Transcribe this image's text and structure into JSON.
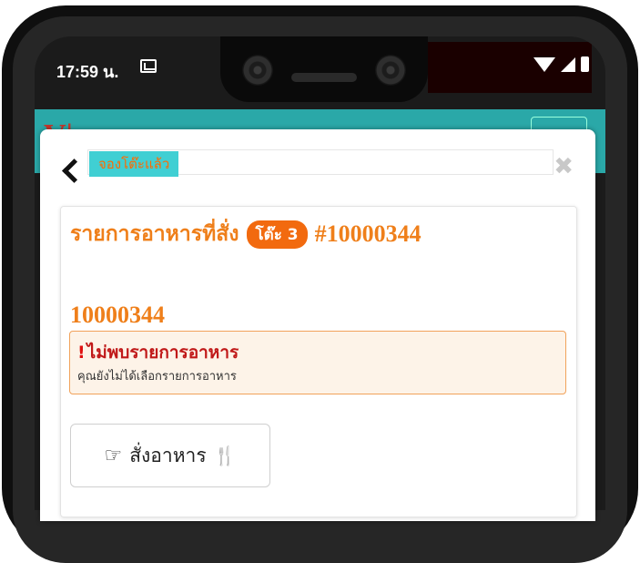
{
  "status_bar": {
    "time": "17:59 น."
  },
  "modal": {
    "tab_label": "จองโต๊ะแล้ว",
    "close_symbol": "✖",
    "title": "รายการอาหารที่สั่ง",
    "table_badge": "โต๊ะ 3",
    "order_number_header": "#10000344",
    "order_number": "10000344",
    "alert": {
      "title": "ไม่พบรายการอาหาร",
      "subtitle": "คุณยังไม่ได้เลือกรายการอาหาร"
    },
    "order_button": {
      "label": "สั่งอาหาร"
    }
  },
  "icons": {
    "back": "chevron-left-icon",
    "close": "close-icon",
    "hand": "hand-point-icon",
    "utensils": "utensils-icon",
    "mail": "mail-icon",
    "wifi": "wifi-icon",
    "signal": "signal-icon",
    "battery": "battery-icon"
  },
  "colors": {
    "accent": "#ef7f1a",
    "tab_bg": "#40cfd3",
    "alert_text": "#c01818",
    "header_bg": "#2aa8a8"
  }
}
